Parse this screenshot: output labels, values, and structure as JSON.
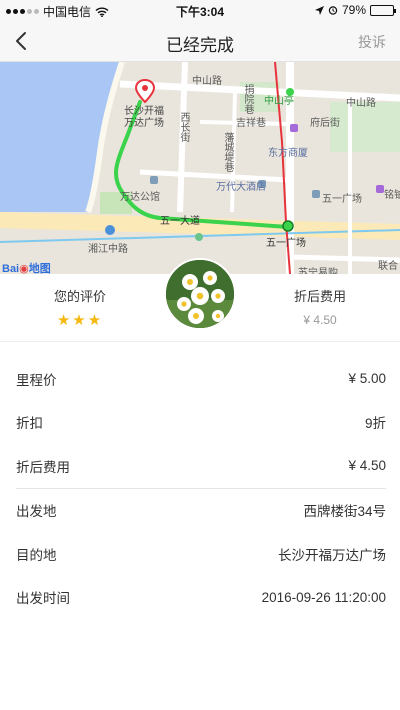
{
  "status_bar": {
    "carrier": "中国电信",
    "time": "下午3:04",
    "battery": "79%",
    "battery_level": 0.79
  },
  "nav": {
    "title": "已经完成",
    "action": "投诉",
    "back_icon": "chevron-left-icon"
  },
  "map": {
    "labels": {
      "zhongshan_rd": "中山路",
      "zhongshan_ting": "中山亭",
      "zhongshan_rd_right": "中山路",
      "tiyu_lane": "捐院巷",
      "fuhou_st": "府后街",
      "jixiang_lane": "吉祥巷",
      "huangcheng_lane": "藩城堤巷",
      "dongfang_building": "东方商厦",
      "xichang_st": "西长街",
      "wanda_plaza": "长沙开福\n万达广场",
      "wanda_apartment": "万达公馆",
      "wandai_hotel": "万代大酒店",
      "wuyi_plaza": "五一广场",
      "wuyi_avenue": "五一大道",
      "wuyi_plaza_station": "五一广场",
      "xiangjiang_rd": "湘江中路",
      "yinghe": "铭铂",
      "lianhe": "联合",
      "suning": "苏宁易购"
    },
    "logo_text": "Bai",
    "logo_text2": "地图",
    "route_color": "#3bd34b",
    "metro_color": "#e8333c",
    "water_color": "#a9c6f5"
  },
  "rating": {
    "label": "您的评价",
    "stars": "★★★",
    "star_count": 3,
    "price_label": "折后费用",
    "price_value": "¥ 4.50"
  },
  "details": [
    {
      "label": "里程价",
      "value": "¥ 5.00"
    },
    {
      "label": "折扣",
      "value": "9折"
    },
    {
      "label": "折后费用",
      "value": "¥ 4.50"
    },
    {
      "label": "出发地",
      "value": "西牌楼街34号"
    },
    {
      "label": "目的地",
      "value": "长沙开福万达广场"
    },
    {
      "label": "出发时间",
      "value": "2016-09-26 11:20:00"
    }
  ]
}
